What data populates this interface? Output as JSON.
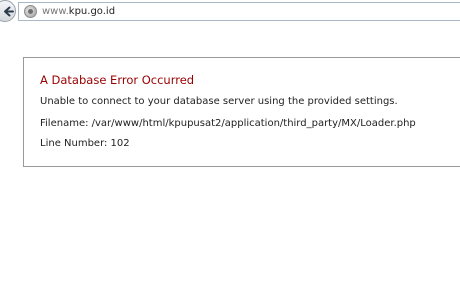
{
  "browser": {
    "url_prefix": "www.",
    "url_domain": "kpu.go.id"
  },
  "error": {
    "title": "A Database Error Occurred",
    "message": "Unable to connect to your database server using the provided settings.",
    "filename": "Filename: /var/www/html/kpupusat2/application/third_party/MX/Loader.php",
    "line_number": "Line Number: 102"
  },
  "colors": {
    "error_title": "#990000",
    "border": "#999999",
    "address_border": "#a9b7c6"
  },
  "icons": {
    "back": "back-arrow-icon",
    "site": "site-identity-icon"
  }
}
